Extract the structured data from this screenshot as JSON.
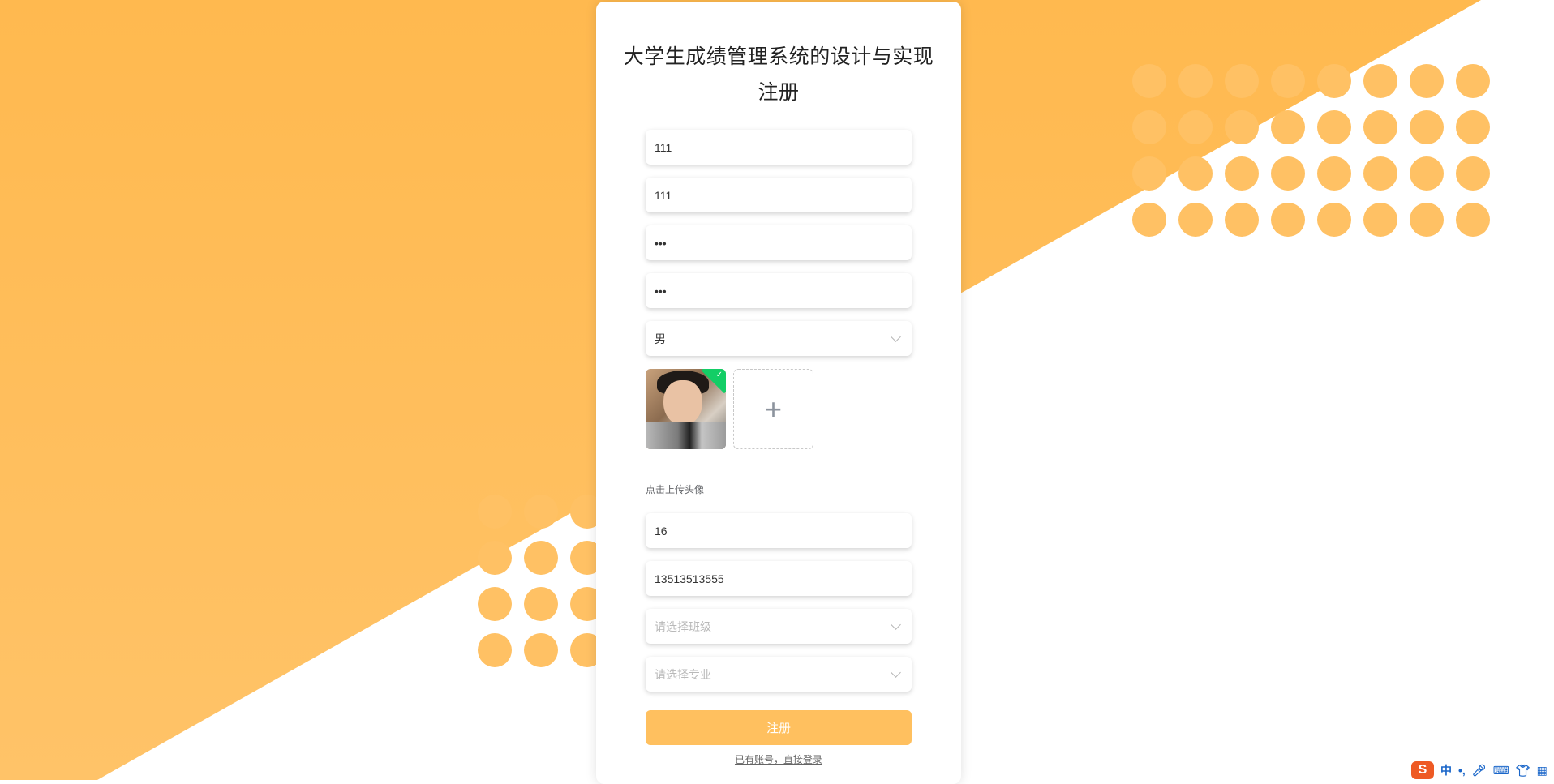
{
  "page": {
    "title_line1": "大学生成绩管理系统的设计与实现",
    "title_line2": "注册"
  },
  "form": {
    "username": "111",
    "name": "111",
    "password": "•••",
    "confirm_password": "•••",
    "gender": "男",
    "upload_hint": "点击上传头像",
    "age": "16",
    "phone": "13513513555",
    "class_placeholder": "请选择班级",
    "major_placeholder": "请选择专业",
    "submit_label": "注册",
    "login_link": "已有账号，直接登录",
    "upload_plus": "+"
  },
  "tray": {
    "ime_logo": "S",
    "ime_mode": "中",
    "ime_punct": "•,",
    "icons": [
      "microphone-icon",
      "keyboard-icon",
      "skin-icon",
      "toolbox-icon"
    ]
  },
  "colors": {
    "accent": "#ffc05f",
    "background_orange": "#ffb94f",
    "upload_success": "#13ce66"
  }
}
